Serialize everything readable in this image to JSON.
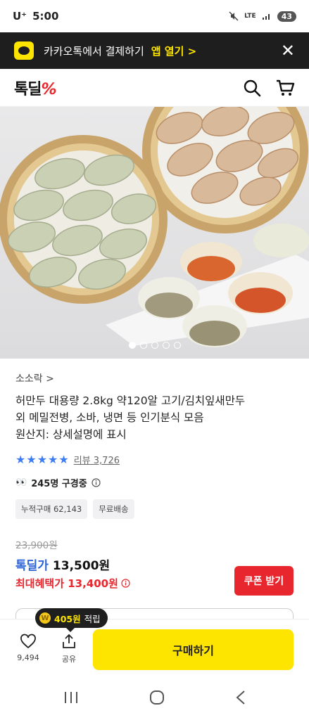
{
  "status_bar": {
    "carrier": "U⁺",
    "time": "5:00",
    "network": "LTE",
    "battery": "43"
  },
  "kakao_banner": {
    "message": "카카오톡에서 결제하기",
    "open_label": "앱 열기 >"
  },
  "header": {
    "brand_text": "톡딜",
    "brand_mark": "%"
  },
  "gallery": {
    "dots": 5,
    "active": 0
  },
  "product": {
    "seller": "소소락 >",
    "title_line1": "허만두 대용량 2.8kg 약120알 고기/김치잎새만두",
    "title_line2": "외 메밀전병, 소바, 냉면 등 인기분식 모음",
    "title_line3": "원산지: 상세설명에 표시",
    "rating_value": 4.8,
    "stars": "★★★★★",
    "review_label": "리뷰 3,726",
    "watch_label": "245명 구경중",
    "tags": [
      "누적구매 62,143",
      "무료배송"
    ],
    "original_price": "23,900원",
    "deal_label": "톡딜가",
    "deal_price": "13,500원",
    "best_label": "최대혜택가 13,400원",
    "coupon_label": "쿠폰 받기"
  },
  "bottom_bar": {
    "points_amount": "405원",
    "points_suffix": "적립",
    "like_count": "9,494",
    "share_label": "공유",
    "buy_label": "구매하기"
  },
  "colors": {
    "kakao_yellow": "#fee500",
    "deal_blue": "#2b63d9",
    "accent_red": "#e8262d"
  }
}
